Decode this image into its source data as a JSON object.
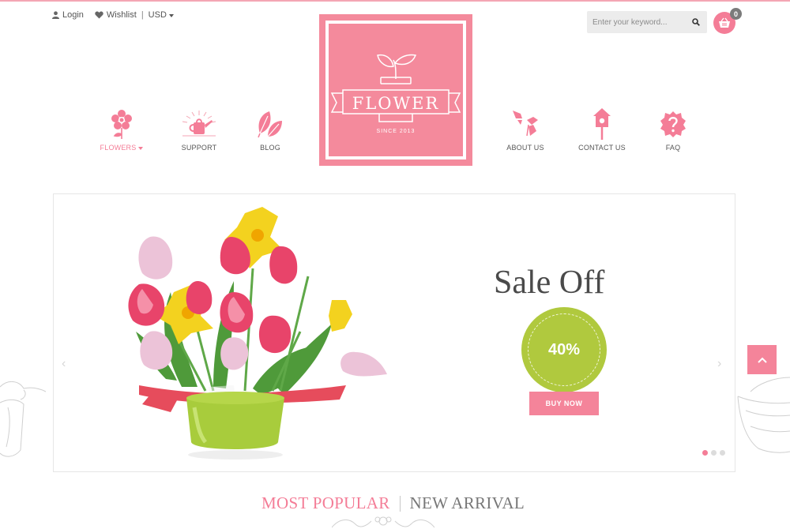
{
  "header": {
    "login_label": "Login",
    "wishlist_label": "Wishlist",
    "currency_label": "USD"
  },
  "search": {
    "placeholder": "Enter your keyword..."
  },
  "cart": {
    "count": "0"
  },
  "logo": {
    "word": "FLOWER",
    "since": "SINCE 2013"
  },
  "nav": {
    "left": [
      {
        "label": "FLOWERS",
        "icon": "flower-icon",
        "active": true
      },
      {
        "label": "SUPPORT",
        "icon": "watering-can-icon"
      },
      {
        "label": "BLOG",
        "icon": "leaves-icon"
      }
    ],
    "right": [
      {
        "label": "ABOUT US",
        "icon": "butterfly-icon"
      },
      {
        "label": "CONTACT US",
        "icon": "birdhouse-icon"
      },
      {
        "label": "FAQ",
        "icon": "question-badge-icon"
      }
    ]
  },
  "slider": {
    "title": "Sale Off",
    "discount": "40%",
    "button_label": "BUY NOW",
    "active_dot": 1,
    "dot_count": 3
  },
  "tabs": {
    "popular": "MOST POPULAR",
    "new_arrival": "NEW ARRIVAL"
  },
  "colors": {
    "brand_pink": "#f48a9c",
    "accent_green": "#b0c93e",
    "text_dark": "#4a4a4a"
  }
}
